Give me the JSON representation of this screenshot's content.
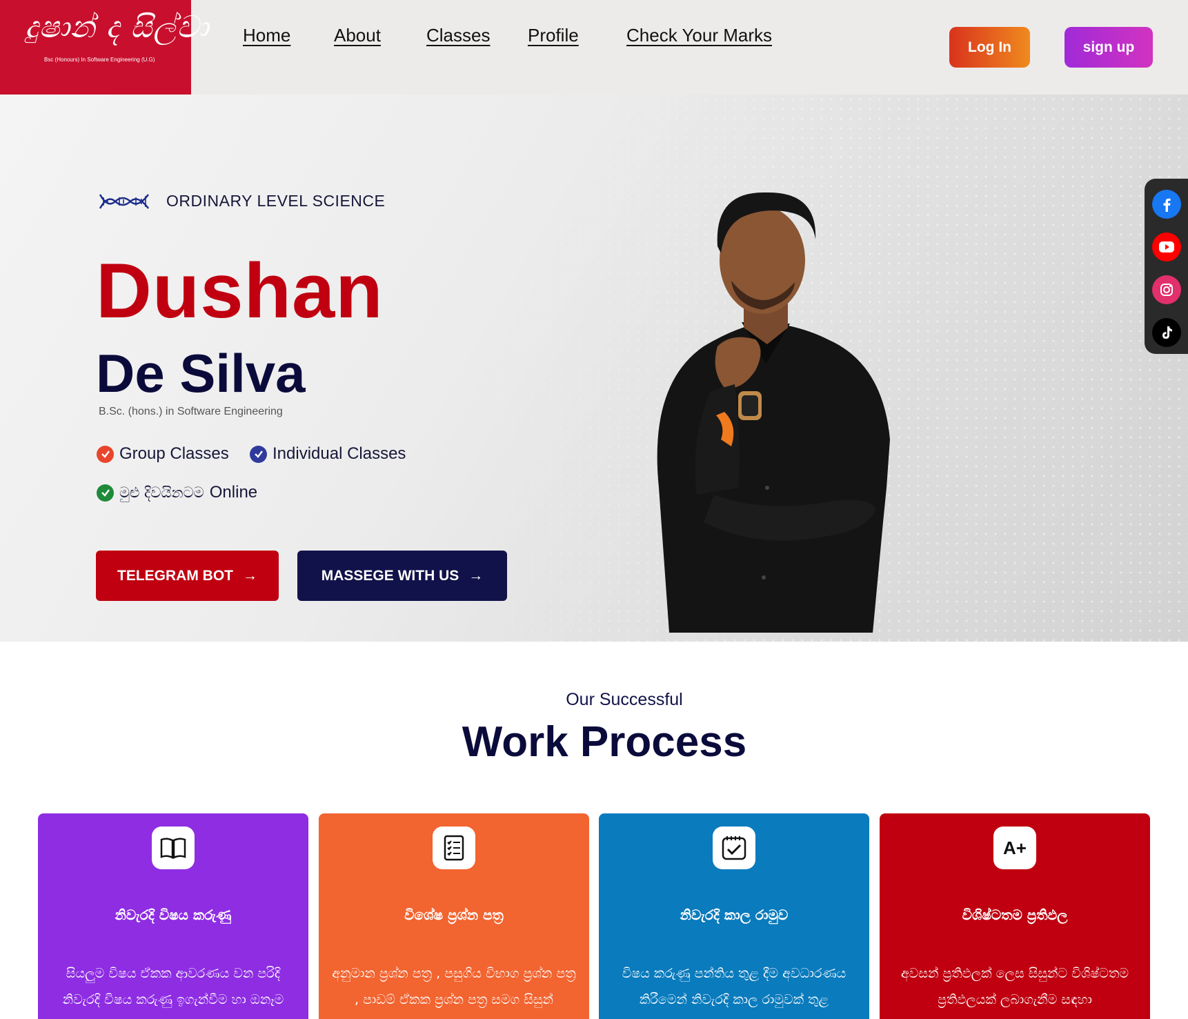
{
  "header": {
    "logo_script": "දුෂාන් ද සිල්වා",
    "logo_subtitle": "Bsc (Honours) In Software Engineering (U.G)",
    "nav": [
      {
        "label": "Home"
      },
      {
        "label": "About"
      },
      {
        "label": "Classes"
      },
      {
        "label": "Profile"
      },
      {
        "label": "Check Your Marks"
      }
    ],
    "login_label": "Log In",
    "signup_label": "sign up"
  },
  "hero": {
    "tagline": "ORDINARY LEVEL SCIENCE",
    "first_name": "Dushan",
    "last_name": "De Silva",
    "degree": "B.Sc. (hons.) in Software Engineering",
    "features": [
      {
        "text": "Group Classes",
        "color": "#e8452c"
      },
      {
        "text": "Individual Classes",
        "color": "#2f3a9c"
      },
      {
        "text_si": "මුළු දිවයිනටම",
        "text": "Online",
        "color": "#1f8a3a"
      }
    ],
    "telegram_label": "TELEGRAM BOT",
    "message_label": "MASSEGE WITH US",
    "arrow": "→"
  },
  "social": [
    {
      "icon": "facebook-icon",
      "color": "#1877f2"
    },
    {
      "icon": "youtube-icon",
      "color": "#ff0000"
    },
    {
      "icon": "instagram-icon",
      "color": "#e1306c"
    },
    {
      "icon": "tiktok-icon",
      "color": "#000000"
    }
  ],
  "section": {
    "subtitle": "Our Successful",
    "title": "Work Process"
  },
  "cards": [
    {
      "icon": "book-icon",
      "color": "#8e2de2",
      "title": "නිවැරදි විෂය කරුණු",
      "text": "සියලුම විෂය ඒකක ආවරණය වන පරිදි නිවැරදි විෂය කරුණු ඉගැන්වීම හා ඔනෑම"
    },
    {
      "icon": "checklist-document-icon",
      "color": "#f26430",
      "title": "විශේෂ ප්‍රශ්න පත්‍ර",
      "text": "අනුමාන ප්‍රශ්න පත්‍ර , පසුගිය විභාග ප්‍රශ්න පත්‍ර , පාඩම් ඒකක ප්‍රශ්න පත්‍ර සමග සිසුන්"
    },
    {
      "icon": "calendar-check-icon",
      "color": "#0a7bbd",
      "title": "නිවැරදි කාල රාමුව",
      "text": "විෂය කරුණු පන්තිය තුළ දීම අවධාරණය කිරීමෙන් නිවැරදි කාල රාමුවක් තුළ"
    },
    {
      "icon": "a-plus-grade-icon",
      "color": "#c00010",
      "title": "විශිෂ්ටතම ප්‍රතිඵල",
      "grade": "A+",
      "text": "අවසන් ප්‍රතිඵලක් ලෙස සිසුන්ට විශිෂ්ටතම ප්‍රතිඵලයක් ලබාගැනීම සඳහා"
    }
  ]
}
